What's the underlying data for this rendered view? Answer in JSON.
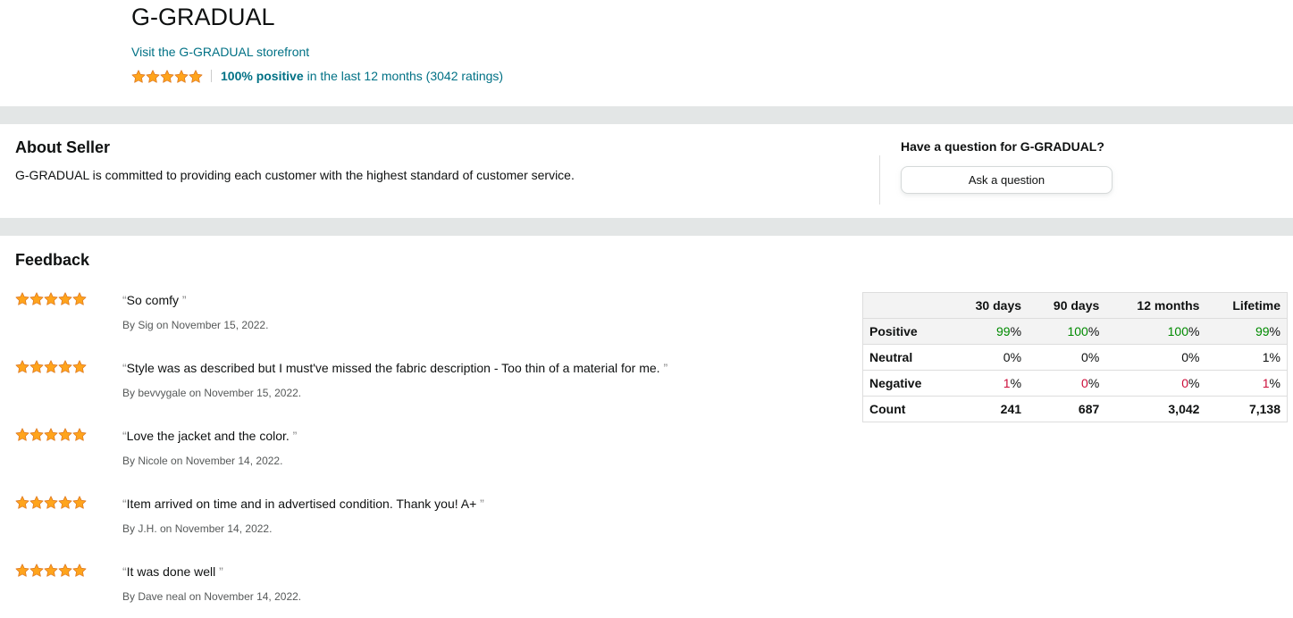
{
  "seller": {
    "name": "G-GRADUAL",
    "storefront_link": "Visit the G-GRADUAL storefront",
    "rating_stars": 5,
    "positive_text": "100% positive",
    "rating_rest": "in the last 12 months (3042 ratings)"
  },
  "about": {
    "title": "About Seller",
    "text": "G-GRADUAL is committed to providing each customer with the highest standard of customer service.",
    "question_title": "Have a question for G-GRADUAL?",
    "ask_button": "Ask a question"
  },
  "feedback": {
    "title": "Feedback",
    "reviews": [
      {
        "stars": 5,
        "text": "So comfy",
        "by": "By Sig on November 15, 2022."
      },
      {
        "stars": 5,
        "text": "Style was as described but I must've missed the fabric description - Too thin of a material for me.",
        "by": "By bevvygale on November 15, 2022."
      },
      {
        "stars": 5,
        "text": "Love the jacket and the color.",
        "by": "By Nicole on November 14, 2022."
      },
      {
        "stars": 5,
        "text": "Item arrived on time and in advertised condition. Thank you! A+",
        "by": "By J.H. on November 14, 2022."
      },
      {
        "stars": 5,
        "text": "It was done well",
        "by": "By Dave neal on November 14, 2022."
      }
    ],
    "table": {
      "columns": [
        "",
        "30 days",
        "90 days",
        "12 months",
        "Lifetime"
      ],
      "rows": [
        {
          "label": "Positive",
          "values": [
            "99",
            "100",
            "100",
            "99"
          ],
          "suffix": "%",
          "num_color": "#008a00"
        },
        {
          "label": "Neutral",
          "values": [
            "0",
            "0",
            "0",
            "1"
          ],
          "suffix": "%",
          "num_color": ""
        },
        {
          "label": "Negative",
          "values": [
            "1",
            "0",
            "0",
            "1"
          ],
          "suffix": "%",
          "num_color": "#cc0c39"
        },
        {
          "label": "Count",
          "values": [
            "241",
            "687",
            "3,042",
            "7,138"
          ],
          "suffix": "",
          "num_color": ""
        }
      ]
    }
  },
  "colors": {
    "star": "#ffa41c",
    "star_stroke": "#de7921",
    "link": "#007185",
    "band": "#e3e6e6"
  }
}
